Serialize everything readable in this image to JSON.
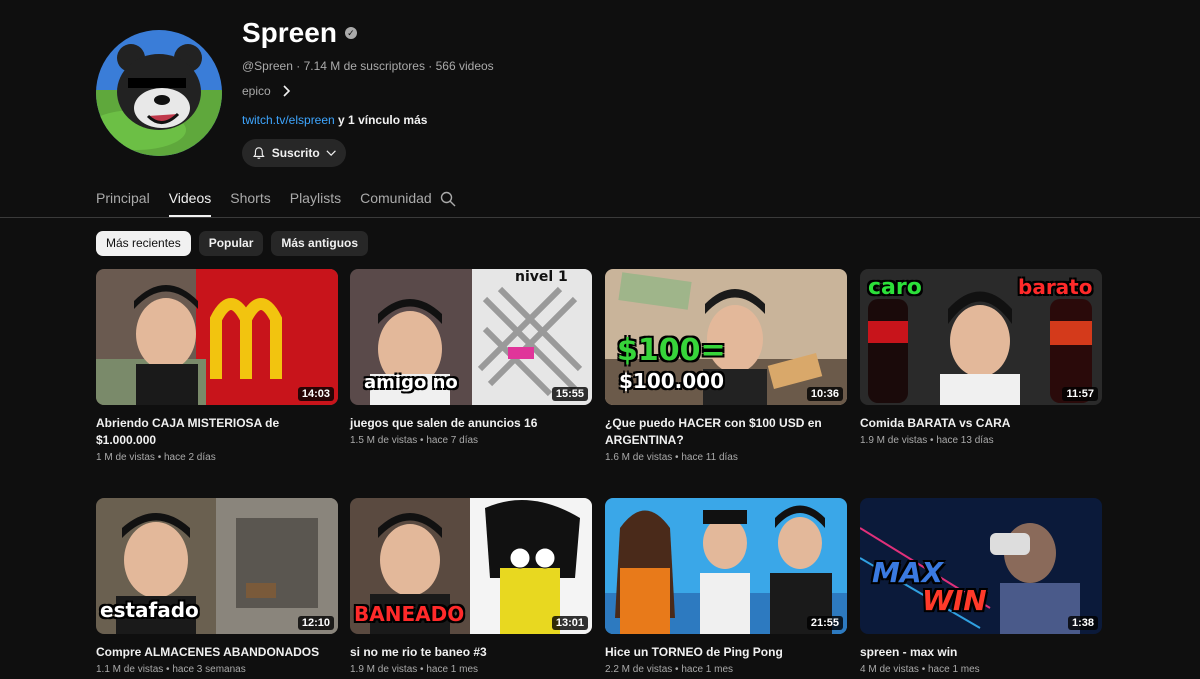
{
  "channel": {
    "name": "Spreen",
    "verified_glyph": "✓",
    "handle": "@Spreen",
    "subscribers": "7.14 M de suscriptores",
    "videos_count": "566 videos",
    "description": "epico",
    "link": "twitch.tv/elspreen",
    "more_links": " y 1 vínculo más",
    "subscribe_label": "Suscrito",
    "separator": " · "
  },
  "tabs": [
    {
      "label": "Principal"
    },
    {
      "label": "Videos"
    },
    {
      "label": "Shorts"
    },
    {
      "label": "Playlists"
    },
    {
      "label": "Comunidad"
    }
  ],
  "chips": [
    {
      "label": "Más recientes"
    },
    {
      "label": "Popular"
    },
    {
      "label": "Más antiguos"
    }
  ],
  "videos": [
    {
      "title": "Abriendo CAJA MISTERIOSA de $1.000.000",
      "views": "1 M de vistas",
      "age": "hace 2 días",
      "duration": "14:03"
    },
    {
      "title": "juegos que salen de anuncios 16",
      "views": "1.5 M de vistas",
      "age": "hace 7 días",
      "duration": "15:55",
      "overlay": "amigo no",
      "overlay2": "nivel 1"
    },
    {
      "title": "¿Que puedo HACER con $100 USD en ARGENTINA?",
      "views": "1.6 M de vistas",
      "age": "hace 11 días",
      "duration": "10:36",
      "overlay": "$100=",
      "overlay2": "$100.000"
    },
    {
      "title": "Comida BARATA vs CARA",
      "views": "1.9 M de vistas",
      "age": "hace 13 días",
      "duration": "11:57",
      "overlay": "caro",
      "overlay2": "barato"
    },
    {
      "title": "Compre ALMACENES ABANDONADOS",
      "views": "1.1 M de vistas",
      "age": "hace 3 semanas",
      "duration": "12:10",
      "overlay": "estafado"
    },
    {
      "title": "si no me rio te baneo #3",
      "views": "1.9 M de vistas",
      "age": "hace 1 mes",
      "duration": "13:01",
      "overlay": "BANEADO"
    },
    {
      "title": "Hice un TORNEO de Ping Pong",
      "views": "2.2 M de vistas",
      "age": "hace 1 mes",
      "duration": "21:55"
    },
    {
      "title": "spreen - max win",
      "views": "4 M de vistas",
      "age": "hace 1 mes",
      "duration": "1:38",
      "overlay": "MAX",
      "overlay2": "WIN"
    }
  ],
  "colors": {
    "background": "#0f0f0f",
    "link": "#3ea6ff",
    "chip": "#272727",
    "text_secondary": "#aaaaaa"
  },
  "icons": {
    "verified": "verified-badge-icon",
    "bell": "bell-icon",
    "chevron": "chevron-down-icon",
    "search": "search-icon",
    "description_arrow": "chevron-right-icon"
  }
}
